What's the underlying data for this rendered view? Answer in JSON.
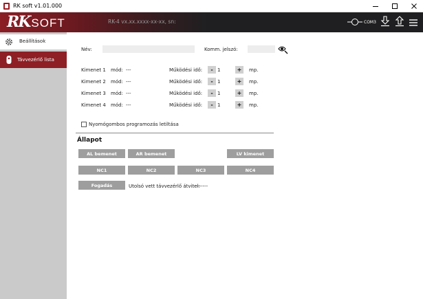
{
  "window": {
    "title": "RK soft v1.01.000"
  },
  "header": {
    "logo_rk": "RK",
    "logo_soft": "SOFT",
    "device_info": "RK-4 vx.xx.xxxx-xx-xx, sn:",
    "com_port": "COM3"
  },
  "sidebar": {
    "items": [
      {
        "label": "Beállítások",
        "icon": "gear-icon",
        "active": true
      },
      {
        "label": "Távvezérlő lista",
        "icon": "remote-icon",
        "active": false
      }
    ]
  },
  "form": {
    "name_label": "Név:",
    "name_value": "",
    "password_label": "Komm. jelszó:",
    "password_value": ""
  },
  "outputs": [
    {
      "label": "Kimenet 1",
      "mode_label": "mód:",
      "mode_value": "---",
      "time_label": "Működési idő:",
      "minus": "-",
      "value": "1",
      "plus": "+",
      "unit": "mp."
    },
    {
      "label": "Kimenet 2",
      "mode_label": "mód:",
      "mode_value": "---",
      "time_label": "Működési idő:",
      "minus": "-",
      "value": "1",
      "plus": "+",
      "unit": "mp."
    },
    {
      "label": "Kimenet 3",
      "mode_label": "mód:",
      "mode_value": "---",
      "time_label": "Működési idő:",
      "minus": "-",
      "value": "1",
      "plus": "+",
      "unit": "mp."
    },
    {
      "label": "Kimenet 4",
      "mode_label": "mód:",
      "mode_value": "---",
      "time_label": "Működési idő:",
      "minus": "-",
      "value": "1",
      "plus": "+",
      "unit": "mp."
    }
  ],
  "options": {
    "disable_button_programming_label": "Nyomógombos programozás letiltása",
    "disable_button_programming_checked": false
  },
  "status": {
    "heading": "Állapot",
    "inputs": [
      "AL bemenet",
      "AR bemenet",
      "LV kimenet"
    ],
    "nc": [
      "NC1",
      "NC2",
      "NC3",
      "NC4"
    ],
    "receive_button": "Fogadás",
    "last_transfer_label": "Utolsó vett távvezérlő átvitel:",
    "last_transfer_value": "--------"
  },
  "colors": {
    "accent": "#8e1f25",
    "header_bg": "#1f1f21",
    "sidebar_bg": "#cacaca",
    "status_button": "#9e9e9e"
  }
}
